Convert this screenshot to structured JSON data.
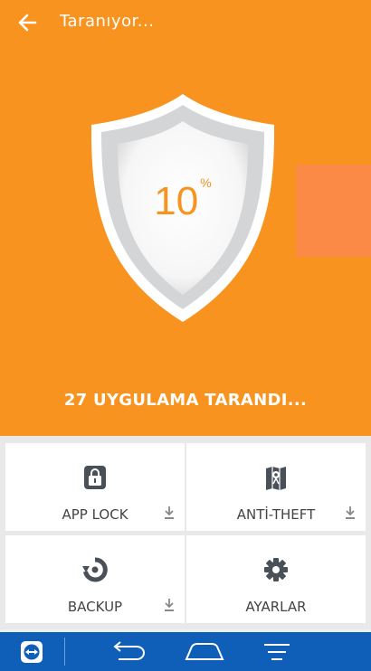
{
  "header": {
    "title": "Taranıyor..."
  },
  "scan": {
    "percent": "10",
    "percent_sign": "%",
    "status": "27 UYGULAMA TARANDI..."
  },
  "tiles": [
    {
      "label": "APP LOCK",
      "icon": "app-lock-icon",
      "download": true
    },
    {
      "label": "ANTİ-THEFT",
      "icon": "anti-theft-icon",
      "download": true
    },
    {
      "label": "BACKUP",
      "icon": "backup-icon",
      "download": true
    },
    {
      "label": "AYARLAR",
      "icon": "settings-gear-icon",
      "download": false
    }
  ],
  "colors": {
    "accent": "#f7931e",
    "navbar": "#0f5fb8",
    "side_tab": "#fa8a45"
  }
}
